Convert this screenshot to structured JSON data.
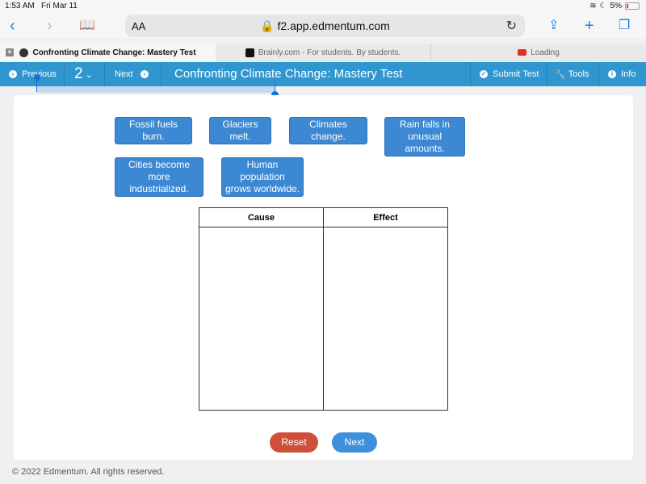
{
  "status_bar": {
    "time": "1:53 AM",
    "date": "Fri Mar 11",
    "battery": "5%"
  },
  "browser": {
    "text_size_label": "AA",
    "url": "f2.app.edmentum.com",
    "icons": [
      "back-icon",
      "forward-icon",
      "bookmarks-icon",
      "share-icon",
      "new-tab-icon",
      "tabs-icon"
    ]
  },
  "tabs": [
    {
      "title": "Confronting Climate Change: Mastery Test",
      "active": true
    },
    {
      "title": "Brainly.com - For students. By students.",
      "active": false
    },
    {
      "title": "Loading",
      "active": false
    }
  ],
  "test_nav": {
    "previous_label": "Previous",
    "question_number": "2",
    "next_label": "Next",
    "title": "Confronting Climate Change: Mastery Test",
    "submit_label": "Submit Test",
    "tools_label": "Tools",
    "info_label": "Info"
  },
  "question": {
    "chips": [
      {
        "line1": "Fossil fuels burn.",
        "line2": ""
      },
      {
        "line1": "Glaciers melt.",
        "line2": ""
      },
      {
        "line1": "Climates change.",
        "line2": ""
      },
      {
        "line1": "Rain falls in",
        "line2": "unusual amounts."
      },
      {
        "line1": "Cities become more",
        "line2": "industrialized."
      },
      {
        "line1": "Human population",
        "line2": "grows worldwide."
      }
    ],
    "table": {
      "headers": [
        "Cause",
        "Effect"
      ]
    },
    "reset_label": "Reset",
    "next_label": "Next"
  },
  "footer": {
    "copyright": "© 2022 Edmentum. All rights reserved."
  },
  "colors": {
    "nav_blue": "#3096cf",
    "chip_blue": "#3c88d2",
    "reset_red": "#cf4f3a",
    "next_blue": "#3e8fdc"
  }
}
